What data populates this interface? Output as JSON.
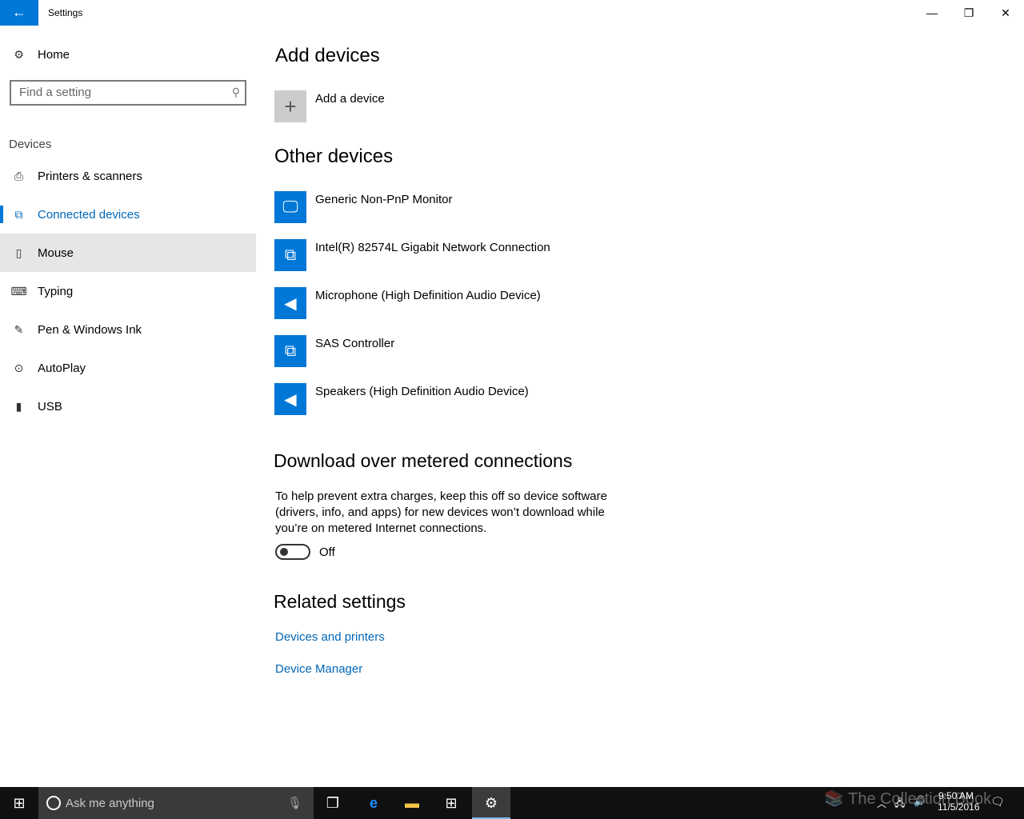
{
  "window": {
    "title": "Settings",
    "back": "←",
    "minimize": "—",
    "restore": "❐",
    "close": "✕"
  },
  "sidebar": {
    "home": "Home",
    "search_placeholder": "Find a setting",
    "section": "Devices",
    "items": [
      {
        "label": "Printers & scanners",
        "icon": "printer-icon"
      },
      {
        "label": "Connected devices",
        "icon": "connected-devices-icon"
      },
      {
        "label": "Mouse",
        "icon": "mouse-icon"
      },
      {
        "label": "Typing",
        "icon": "keyboard-icon"
      },
      {
        "label": "Pen & Windows Ink",
        "icon": "pen-icon"
      },
      {
        "label": "AutoPlay",
        "icon": "autoplay-icon"
      },
      {
        "label": "USB",
        "icon": "usb-icon"
      }
    ]
  },
  "main": {
    "add_heading": "Add devices",
    "add_label": "Add a device",
    "other_heading": "Other devices",
    "devices": [
      {
        "name": "Generic Non-PnP Monitor",
        "icon": "monitor-icon"
      },
      {
        "name": "Intel(R) 82574L Gigabit Network Connection",
        "icon": "devices-icon"
      },
      {
        "name": "Microphone (High Definition Audio Device)",
        "icon": "speaker-icon"
      },
      {
        "name": "SAS Controller",
        "icon": "devices-icon"
      },
      {
        "name": "Speakers (High Definition Audio Device)",
        "icon": "speaker-icon"
      }
    ],
    "metered_heading": "Download over metered connections",
    "metered_text": "To help prevent extra charges, keep this off so device software (drivers, info, and apps) for new devices won’t download while you’re on metered Internet connections.",
    "toggle_state": "Off",
    "related_heading": "Related settings",
    "links": [
      "Devices and printers",
      "Device Manager"
    ]
  },
  "taskbar": {
    "search": "Ask me anything",
    "time": "9:50 AM",
    "date": "11/5/2016",
    "watermark": "The Collection Book"
  },
  "colors": {
    "accent": "#0078d7",
    "link": "#0067b8"
  }
}
